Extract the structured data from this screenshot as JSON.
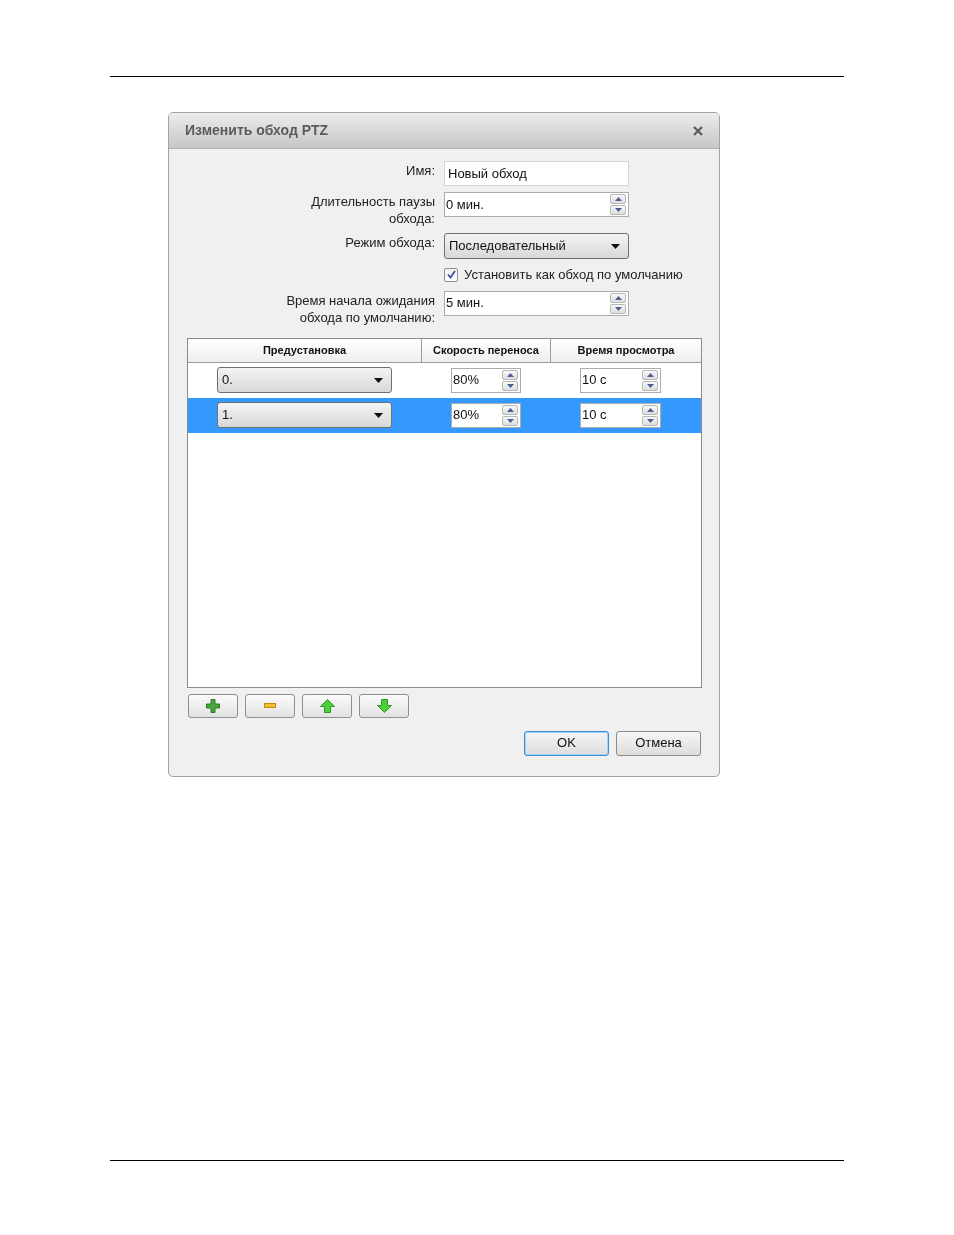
{
  "window": {
    "title": "Изменить обход PTZ"
  },
  "fields": [
    {
      "kind": "text",
      "label": "Имя:",
      "value": "Новый обход"
    },
    {
      "kind": "spin",
      "label": "Длительность паузы обхода:",
      "value": "0 мин."
    },
    {
      "kind": "select",
      "label": "Режим обхода:",
      "value": "Последовательный"
    },
    {
      "kind": "checkbox",
      "label": "Установить как обход по умолчанию",
      "checked": true
    },
    {
      "kind": "spin",
      "label": "Время начала ожидания обхода по умолчанию:",
      "value": "5 мин."
    }
  ],
  "table": {
    "columns": [
      "Предустановка",
      "Скорость переноса",
      "Время просмотра"
    ],
    "rows": [
      {
        "preset": "0.",
        "speed": "80%",
        "time": "10 с",
        "selected": false
      },
      {
        "preset": "1.",
        "speed": "80%",
        "time": "10 с",
        "selected": true
      }
    ]
  },
  "buttons": [
    {
      "label": "OK",
      "default": true
    },
    {
      "label": "Отмена",
      "default": false
    }
  ]
}
